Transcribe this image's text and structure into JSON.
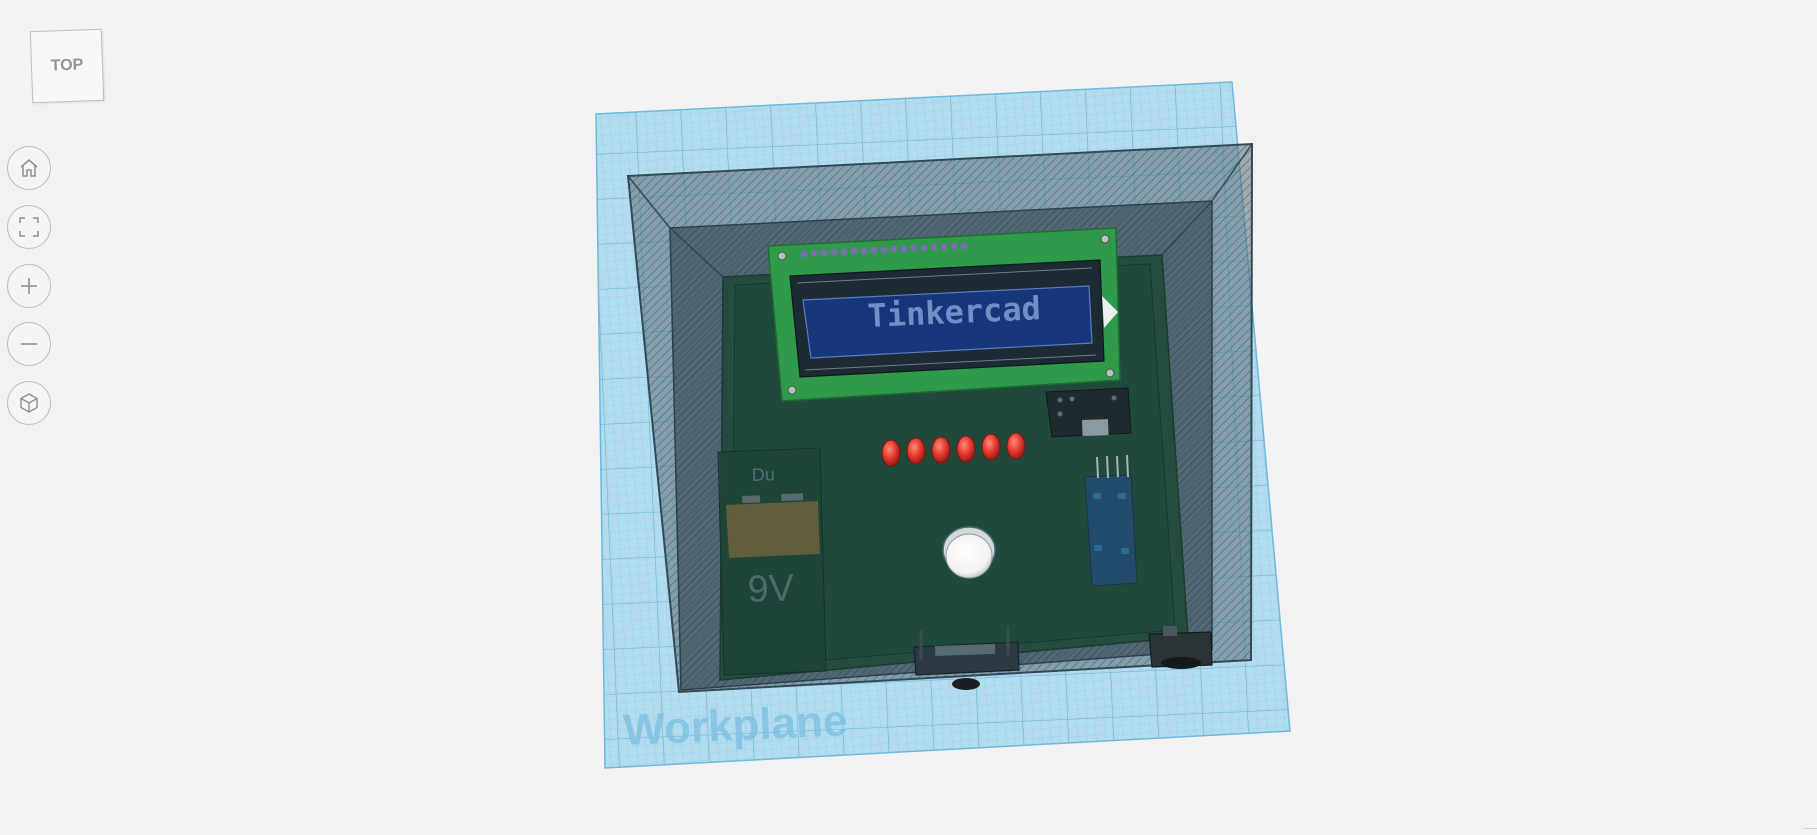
{
  "viewcube": {
    "label": "TOP"
  },
  "nav": {
    "home": "home-view",
    "fit": "fit-all",
    "zoom_in": "zoom-in",
    "zoom_out": "zoom-out",
    "projection": "perspective-toggle"
  },
  "scene": {
    "workplane_label": "Workplane",
    "lcd_text": "Tinkercad",
    "battery_label": "9V",
    "battery_brand": "Du",
    "led_count": 6
  },
  "colors": {
    "workplane": "#a9d6ec",
    "grid": "#7cc0e0",
    "pcb": "#1f4a3b",
    "lcd_board": "#2e9a4a",
    "lcd_screen": "#15367a",
    "led": "#e43a2f",
    "enclosure_edge": "#324a58"
  }
}
